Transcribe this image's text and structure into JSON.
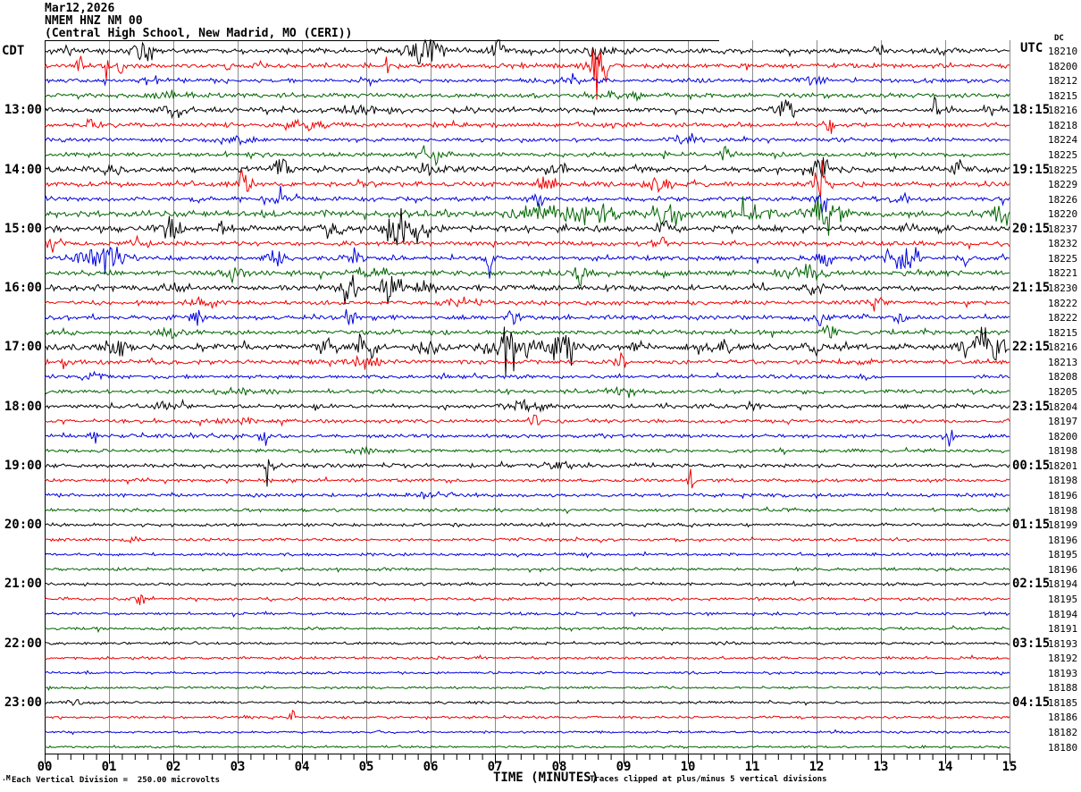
{
  "header": {
    "date": "Mar12,2026",
    "station": "NMEM HNZ NM 00",
    "location": "(Central High School, New Madrid, MO (CERI))",
    "left_timezone": "CDT",
    "right_timezone": "UTC",
    "dc_column_header": "DC"
  },
  "footer": {
    "division_note": "Each Vertical Division =  250.00 microvolts",
    "time_axis_label": "TIME (MINUTES)",
    "clip_note": "Traces clipped at plus/minus 5 vertical divisions",
    "watermark": ".M"
  },
  "chart_data": {
    "type": "line",
    "subtype": "helicorder-seismogram",
    "title": "NMEM HNZ NM 00 (Central High School, New Madrid, MO (CERI)) Mar12,2026",
    "xlabel": "TIME (MINUTES)",
    "x_range_minutes": [
      0,
      15
    ],
    "x_tick_labels": [
      "00",
      "01",
      "02",
      "03",
      "04",
      "05",
      "06",
      "07",
      "08",
      "09",
      "10",
      "11",
      "12",
      "13",
      "14",
      "15"
    ],
    "minutes_per_row": 15,
    "grid": true,
    "palette": {
      "black": "#000000",
      "red": "#f00000",
      "blue": "#0000dd",
      "green": "#006400",
      "grid": "#8c8c8c"
    },
    "clip_divisions": 5,
    "microvolts_per_division": 250.0,
    "rows": [
      {
        "cdt": null,
        "utc": null,
        "dc": "18210",
        "color": "black",
        "noise": 2.2,
        "events": [
          [
            0.35,
            0.05,
            6
          ],
          [
            1.55,
            0.15,
            10
          ],
          [
            5.9,
            0.25,
            13
          ],
          [
            7.0,
            0.1,
            15
          ],
          [
            8.6,
            0.15,
            6
          ],
          [
            13.0,
            0.1,
            5
          ]
        ],
        "flat": null
      },
      {
        "cdt": null,
        "utc": null,
        "dc": "18200",
        "color": "red",
        "noise": 1.9,
        "events": [
          [
            0.55,
            0.05,
            12
          ],
          [
            0.95,
            0.05,
            9
          ],
          [
            1.17,
            0.04,
            8
          ],
          [
            2.85,
            0.05,
            6
          ],
          [
            5.32,
            0.03,
            12
          ],
          [
            8.6,
            0.12,
            30
          ],
          [
            12.2,
            0.04,
            5
          ]
        ],
        "flat": null
      },
      {
        "cdt": null,
        "utc": null,
        "dc": "18212",
        "color": "blue",
        "noise": 1.6,
        "events": [
          [
            1.6,
            0.3,
            3
          ],
          [
            8.2,
            0.3,
            3
          ],
          [
            12.0,
            0.2,
            3
          ]
        ],
        "flat": null
      },
      {
        "cdt": null,
        "utc": null,
        "dc": "18215",
        "color": "green",
        "noise": 1.8,
        "events": [
          [
            2.0,
            0.3,
            3
          ],
          [
            9.0,
            0.3,
            3
          ]
        ],
        "flat": null
      },
      {
        "cdt": "13:00",
        "utc": "18:15",
        "dc": "18216",
        "color": "black",
        "noise": 2.0,
        "events": [
          [
            2.0,
            0.2,
            4
          ],
          [
            5.0,
            0.3,
            4
          ],
          [
            11.5,
            0.15,
            7
          ],
          [
            13.85,
            0.04,
            14
          ],
          [
            14.8,
            0.1,
            5
          ]
        ],
        "flat": null
      },
      {
        "cdt": null,
        "utc": null,
        "dc": "18218",
        "color": "red",
        "noise": 1.8,
        "events": [
          [
            0.75,
            0.08,
            11
          ],
          [
            4.0,
            0.3,
            4
          ],
          [
            12.2,
            0.08,
            6
          ]
        ],
        "flat": null
      },
      {
        "cdt": null,
        "utc": null,
        "dc": "18224",
        "color": "blue",
        "noise": 1.6,
        "events": [
          [
            3.0,
            0.3,
            3
          ],
          [
            10.0,
            0.3,
            3
          ]
        ],
        "flat": null
      },
      {
        "cdt": null,
        "utc": null,
        "dc": "18225",
        "color": "green",
        "noise": 1.8,
        "events": [
          [
            6.0,
            0.3,
            3
          ],
          [
            10.6,
            0.12,
            7
          ]
        ],
        "flat": null
      },
      {
        "cdt": "14:00",
        "utc": "19:15",
        "dc": "18225",
        "color": "black",
        "noise": 2.4,
        "events": [
          [
            1.0,
            0.2,
            5
          ],
          [
            3.7,
            0.15,
            8
          ],
          [
            6.0,
            0.2,
            5
          ],
          [
            8.0,
            0.2,
            5
          ],
          [
            12.05,
            0.12,
            12
          ],
          [
            14.2,
            0.1,
            6
          ]
        ],
        "flat": null
      },
      {
        "cdt": null,
        "utc": null,
        "dc": "18229",
        "color": "red",
        "noise": 2.0,
        "events": [
          [
            3.1,
            0.1,
            13
          ],
          [
            7.8,
            0.12,
            9
          ],
          [
            9.5,
            0.2,
            5
          ],
          [
            12.05,
            0.1,
            16
          ]
        ],
        "flat": null
      },
      {
        "cdt": null,
        "utc": null,
        "dc": "18226",
        "color": "blue",
        "noise": 1.8,
        "events": [
          [
            3.6,
            0.15,
            9
          ],
          [
            7.7,
            0.1,
            7
          ],
          [
            12.1,
            0.1,
            11
          ],
          [
            13.3,
            0.12,
            9
          ],
          [
            15.0,
            0.1,
            6
          ]
        ],
        "flat": null
      },
      {
        "cdt": null,
        "utc": null,
        "dc": "18220",
        "color": "green",
        "noise": 2.6,
        "events": [
          [
            7.6,
            0.3,
            7
          ],
          [
            8.5,
            0.4,
            8
          ],
          [
            9.7,
            0.25,
            11
          ],
          [
            11.0,
            0.3,
            5
          ],
          [
            12.2,
            0.3,
            8
          ],
          [
            14.9,
            0.15,
            13
          ]
        ],
        "flat": null
      },
      {
        "cdt": "15:00",
        "utc": "20:15",
        "dc": "18237",
        "color": "black",
        "noise": 2.4,
        "events": [
          [
            1.95,
            0.15,
            10
          ],
          [
            2.75,
            0.1,
            7
          ],
          [
            4.5,
            0.2,
            6
          ],
          [
            5.45,
            0.15,
            18
          ],
          [
            5.9,
            0.15,
            8
          ],
          [
            9.6,
            0.1,
            6
          ],
          [
            13.4,
            0.1,
            5
          ],
          [
            14.0,
            0.1,
            5
          ]
        ],
        "flat": null
      },
      {
        "cdt": null,
        "utc": null,
        "dc": "18232",
        "color": "red",
        "noise": 1.8,
        "events": [
          [
            0.1,
            0.05,
            9
          ],
          [
            1.5,
            0.2,
            5
          ],
          [
            9.5,
            0.2,
            4
          ],
          [
            15.55,
            0.04,
            12
          ]
        ],
        "flat": null
      },
      {
        "cdt": null,
        "utc": null,
        "dc": "18225",
        "color": "blue",
        "noise": 1.9,
        "events": [
          [
            0.9,
            0.35,
            10
          ],
          [
            3.6,
            0.12,
            12
          ],
          [
            4.8,
            0.15,
            7
          ],
          [
            6.9,
            0.08,
            6
          ],
          [
            12.1,
            0.15,
            9
          ],
          [
            13.3,
            0.3,
            10
          ],
          [
            14.3,
            0.1,
            6
          ]
        ],
        "flat": null
      },
      {
        "cdt": null,
        "utc": null,
        "dc": "18221",
        "color": "green",
        "noise": 2.0,
        "events": [
          [
            3.0,
            0.15,
            6
          ],
          [
            5.0,
            0.3,
            4
          ],
          [
            8.3,
            0.1,
            7
          ],
          [
            11.8,
            0.3,
            7
          ],
          [
            15.4,
            0.04,
            10
          ]
        ],
        "flat": null
      },
      {
        "cdt": "16:00",
        "utc": "21:15",
        "dc": "18230",
        "color": "black",
        "noise": 2.2,
        "events": [
          [
            2.0,
            0.2,
            4
          ],
          [
            4.75,
            0.15,
            10
          ],
          [
            5.35,
            0.15,
            12
          ],
          [
            5.95,
            0.12,
            10
          ],
          [
            12.0,
            0.15,
            5
          ]
        ],
        "flat": null
      },
      {
        "cdt": null,
        "utc": null,
        "dc": "18222",
        "color": "red",
        "noise": 1.7,
        "events": [
          [
            2.5,
            0.2,
            4
          ],
          [
            6.5,
            0.3,
            3
          ],
          [
            13.0,
            0.2,
            4
          ]
        ],
        "flat": null
      },
      {
        "cdt": null,
        "utc": null,
        "dc": "18222",
        "color": "blue",
        "noise": 1.8,
        "events": [
          [
            2.35,
            0.1,
            9
          ],
          [
            4.75,
            0.1,
            7
          ],
          [
            7.3,
            0.1,
            7
          ],
          [
            12.05,
            0.1,
            6
          ],
          [
            13.3,
            0.1,
            7
          ],
          [
            15.15,
            0.08,
            8
          ]
        ],
        "flat": null
      },
      {
        "cdt": null,
        "utc": null,
        "dc": "18215",
        "color": "green",
        "noise": 1.8,
        "events": [
          [
            2.0,
            0.3,
            4
          ],
          [
            12.2,
            0.12,
            7
          ],
          [
            15.45,
            0.04,
            14
          ]
        ],
        "flat": null
      },
      {
        "cdt": "17:00",
        "utc": "22:15",
        "dc": "18216",
        "color": "black",
        "noise": 2.4,
        "events": [
          [
            1.1,
            0.15,
            9
          ],
          [
            4.4,
            0.12,
            16
          ],
          [
            5.0,
            0.15,
            7
          ],
          [
            6.0,
            0.15,
            10
          ],
          [
            7.2,
            0.3,
            18
          ],
          [
            8.0,
            0.25,
            10
          ],
          [
            9.2,
            0.1,
            6
          ],
          [
            10.5,
            0.2,
            4
          ],
          [
            12.0,
            0.1,
            7
          ],
          [
            14.6,
            0.35,
            12
          ]
        ],
        "flat": null
      },
      {
        "cdt": null,
        "utc": null,
        "dc": "18213",
        "color": "red",
        "noise": 1.8,
        "events": [
          [
            0.3,
            0.1,
            5
          ],
          [
            5.0,
            0.3,
            3
          ],
          [
            8.95,
            0.06,
            14
          ]
        ],
        "flat": null
      },
      {
        "cdt": null,
        "utc": null,
        "dc": "18208",
        "color": "blue",
        "noise": 1.5,
        "events": [
          [
            0.8,
            0.2,
            4
          ],
          [
            12.7,
            0.05,
            5
          ]
        ],
        "flat": [
          13.05,
          14.4
        ]
      },
      {
        "cdt": null,
        "utc": null,
        "dc": "18205",
        "color": "green",
        "noise": 1.6,
        "events": [
          [
            3.0,
            0.3,
            3
          ],
          [
            9.0,
            0.3,
            3
          ]
        ],
        "flat": null
      },
      {
        "cdt": "18:00",
        "utc": "23:15",
        "dc": "18204",
        "color": "black",
        "noise": 1.6,
        "events": [
          [
            2.0,
            0.3,
            3
          ],
          [
            7.5,
            0.3,
            4
          ],
          [
            11.0,
            0.2,
            3
          ]
        ],
        "flat": null
      },
      {
        "cdt": null,
        "utc": null,
        "dc": "18197",
        "color": "red",
        "noise": 1.5,
        "events": [
          [
            3.0,
            0.3,
            3
          ],
          [
            7.6,
            0.06,
            12
          ]
        ],
        "flat": null
      },
      {
        "cdt": null,
        "utc": null,
        "dc": "18200",
        "color": "blue",
        "noise": 1.5,
        "events": [
          [
            0.75,
            0.06,
            11
          ],
          [
            3.4,
            0.06,
            10
          ],
          [
            14.05,
            0.08,
            9
          ]
        ],
        "flat": null
      },
      {
        "cdt": null,
        "utc": null,
        "dc": "18198",
        "color": "green",
        "noise": 1.4,
        "events": [
          [
            5.0,
            0.3,
            2.5
          ]
        ],
        "flat": null
      },
      {
        "cdt": "19:00",
        "utc": "00:15",
        "dc": "18201",
        "color": "black",
        "noise": 1.5,
        "events": [
          [
            3.5,
            0.08,
            9
          ],
          [
            8.0,
            0.2,
            3
          ]
        ],
        "flat": null
      },
      {
        "cdt": null,
        "utc": null,
        "dc": "18198",
        "color": "red",
        "noise": 1.4,
        "events": [
          [
            10.05,
            0.05,
            14
          ]
        ],
        "flat": null
      },
      {
        "cdt": null,
        "utc": null,
        "dc": "18196",
        "color": "blue",
        "noise": 1.3,
        "events": [
          [
            6.0,
            0.3,
            2
          ]
        ],
        "flat": null
      },
      {
        "cdt": null,
        "utc": null,
        "dc": "18198",
        "color": "green",
        "noise": 1.3,
        "events": [],
        "flat": null
      },
      {
        "cdt": "20:00",
        "utc": "01:15",
        "dc": "18199",
        "color": "black",
        "noise": 1.3,
        "events": [],
        "flat": null
      },
      {
        "cdt": null,
        "utc": null,
        "dc": "18196",
        "color": "red",
        "noise": 1.2,
        "events": [
          [
            1.4,
            0.1,
            4
          ]
        ],
        "flat": null
      },
      {
        "cdt": null,
        "utc": null,
        "dc": "18195",
        "color": "blue",
        "noise": 1.2,
        "events": [],
        "flat": null
      },
      {
        "cdt": null,
        "utc": null,
        "dc": "18196",
        "color": "green",
        "noise": 1.2,
        "events": [],
        "flat": null
      },
      {
        "cdt": "21:00",
        "utc": "02:15",
        "dc": "18194",
        "color": "black",
        "noise": 1.2,
        "events": [],
        "flat": null
      },
      {
        "cdt": null,
        "utc": null,
        "dc": "18195",
        "color": "red",
        "noise": 1.2,
        "events": [
          [
            1.5,
            0.1,
            4
          ]
        ],
        "flat": null
      },
      {
        "cdt": null,
        "utc": null,
        "dc": "18194",
        "color": "blue",
        "noise": 1.1,
        "events": [],
        "flat": null
      },
      {
        "cdt": null,
        "utc": null,
        "dc": "18191",
        "color": "green",
        "noise": 1.1,
        "events": [],
        "flat": null
      },
      {
        "cdt": "22:00",
        "utc": "03:15",
        "dc": "18193",
        "color": "black",
        "noise": 1.1,
        "events": [],
        "flat": null
      },
      {
        "cdt": null,
        "utc": null,
        "dc": "18192",
        "color": "red",
        "noise": 1.1,
        "events": [],
        "flat": null
      },
      {
        "cdt": null,
        "utc": null,
        "dc": "18193",
        "color": "blue",
        "noise": 1.0,
        "events": [],
        "flat": null
      },
      {
        "cdt": null,
        "utc": null,
        "dc": "18188",
        "color": "green",
        "noise": 1.0,
        "events": [],
        "flat": null
      },
      {
        "cdt": "23:00",
        "utc": "04:15",
        "dc": "18185",
        "color": "black",
        "noise": 1.0,
        "events": [
          [
            0.5,
            0.2,
            2
          ]
        ],
        "flat": null
      },
      {
        "cdt": null,
        "utc": null,
        "dc": "18186",
        "color": "red",
        "noise": 1.0,
        "events": [
          [
            3.85,
            0.04,
            8
          ]
        ],
        "flat": null
      },
      {
        "cdt": null,
        "utc": null,
        "dc": "18182",
        "color": "blue",
        "noise": 0.9,
        "events": [],
        "flat": null
      },
      {
        "cdt": null,
        "utc": null,
        "dc": "18180",
        "color": "green",
        "noise": 0.9,
        "events": [],
        "flat": null
      }
    ]
  }
}
